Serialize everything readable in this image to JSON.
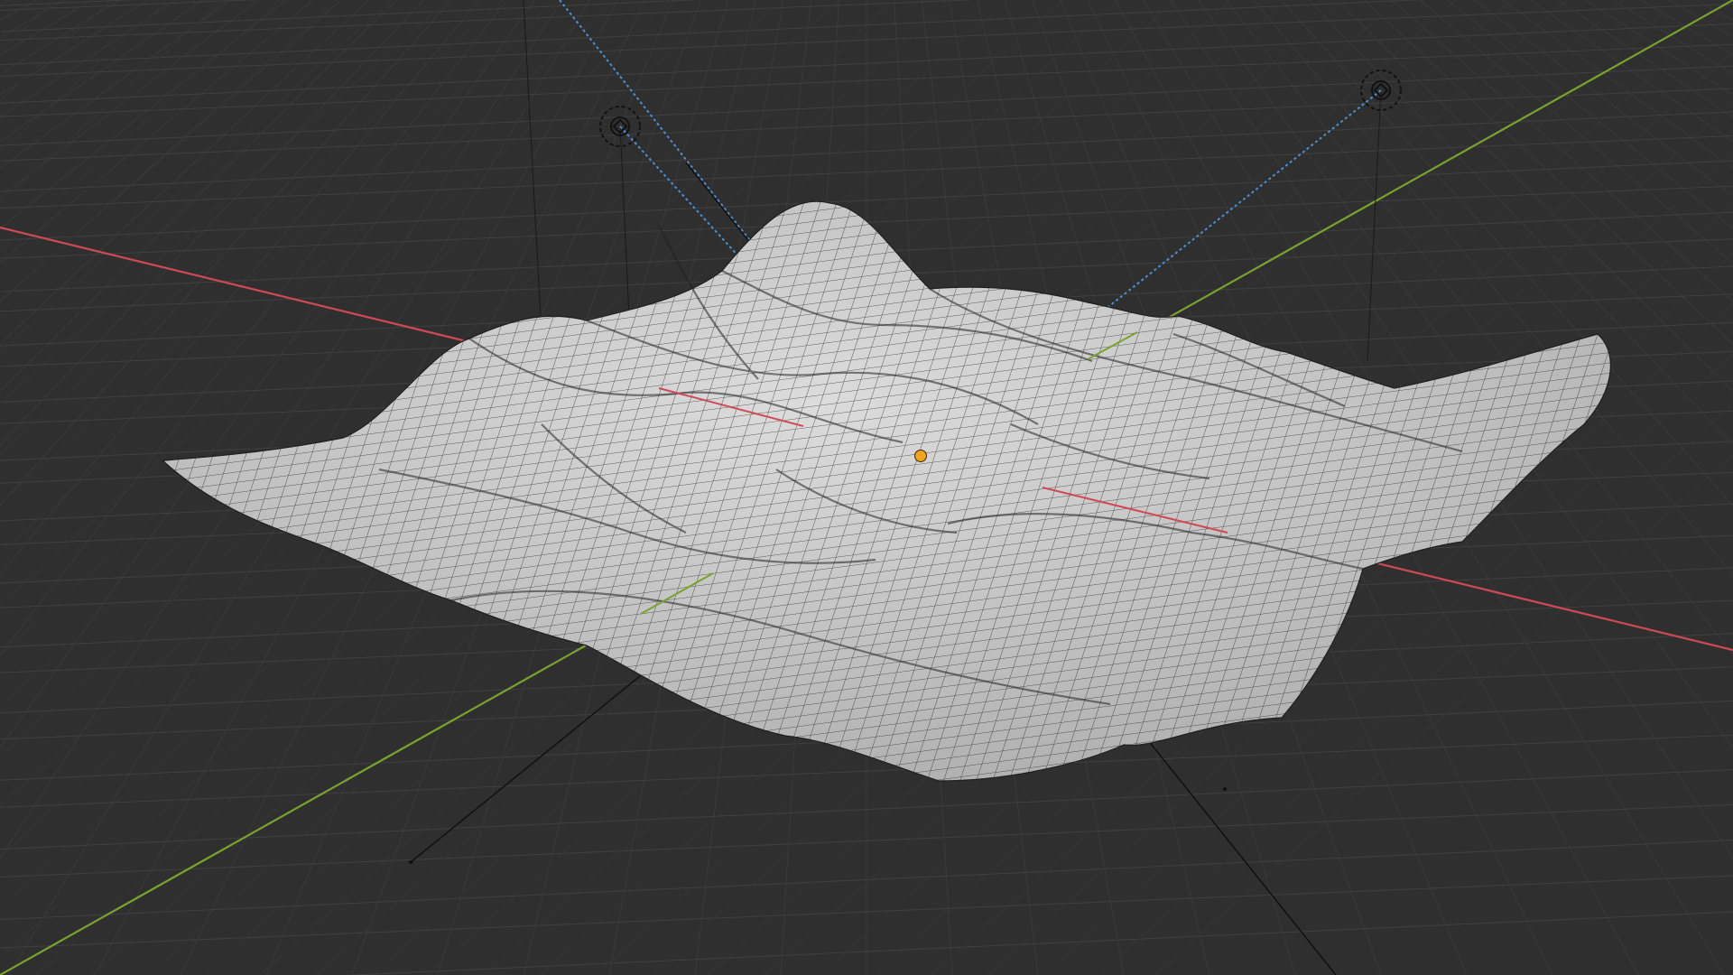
{
  "viewport": {
    "mode": "3d-viewport",
    "shading": "solid-wireframe",
    "colors": {
      "background": "#2f2f2f",
      "grid": "#3a3a3a",
      "grid_major": "#404040",
      "x_axis": "#cf4a55",
      "y_axis": "#7aa22f",
      "mesh_fill": "#bdbdbd",
      "mesh_wire": "#1a1a1a",
      "origin": "#f0a31f",
      "light": "#111111",
      "light_line": "#4e8fd0"
    }
  },
  "scene": {
    "objects": [
      {
        "name_icon": "terrain-mesh-object",
        "type": "mesh"
      },
      {
        "name_icon": "light-icon",
        "type": "light"
      },
      {
        "name_icon": "light-icon",
        "type": "light"
      },
      {
        "name_icon": "camera-icon",
        "type": "camera"
      }
    ]
  }
}
